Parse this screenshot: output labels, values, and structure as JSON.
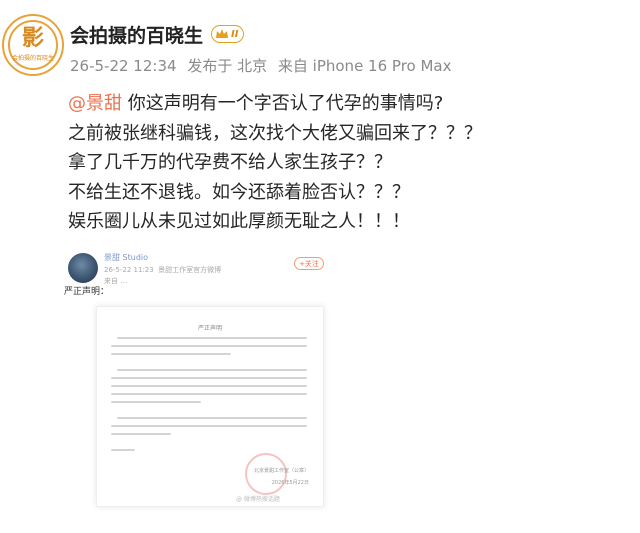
{
  "user": {
    "name": "会拍摄的百晓生",
    "vip_level": "II",
    "avatar_char": "影",
    "avatar_sub": "会拍摄的百晓生"
  },
  "meta": {
    "date": "26-5-22 12:34",
    "location": "发布于 北京",
    "device": "来自 iPhone 16 Pro Max"
  },
  "post": {
    "mention": "@景甜",
    "line1_rest": " 你这声明有一个字否认了代孕的事情吗?",
    "lines": [
      "之前被张继科骗钱，这次找个大佬又骗回来了？？？",
      "拿了几千万的代孕费不给人家生孩子？？",
      "不给生还不退钱。如今还舔着脸否认？？？",
      "娱乐圈儿从未见过如此厚颜无耻之人！！！"
    ]
  },
  "embed": {
    "name": "景甜 Studio",
    "date": "26-5-22 11:23",
    "source": "景甜工作室官方微博",
    "from": "来自 …",
    "follow": "+关注",
    "text": "严正声明：",
    "doc_title": "严正声明",
    "doc_sign": "北京景甜工作室（公章）",
    "doc_date": "2026年5月22日",
    "watermark": "@ 微博热搜话题"
  },
  "colors": {
    "accent": "#eb7350",
    "meta": "#8a8a8a",
    "vip": "#e5a020"
  }
}
